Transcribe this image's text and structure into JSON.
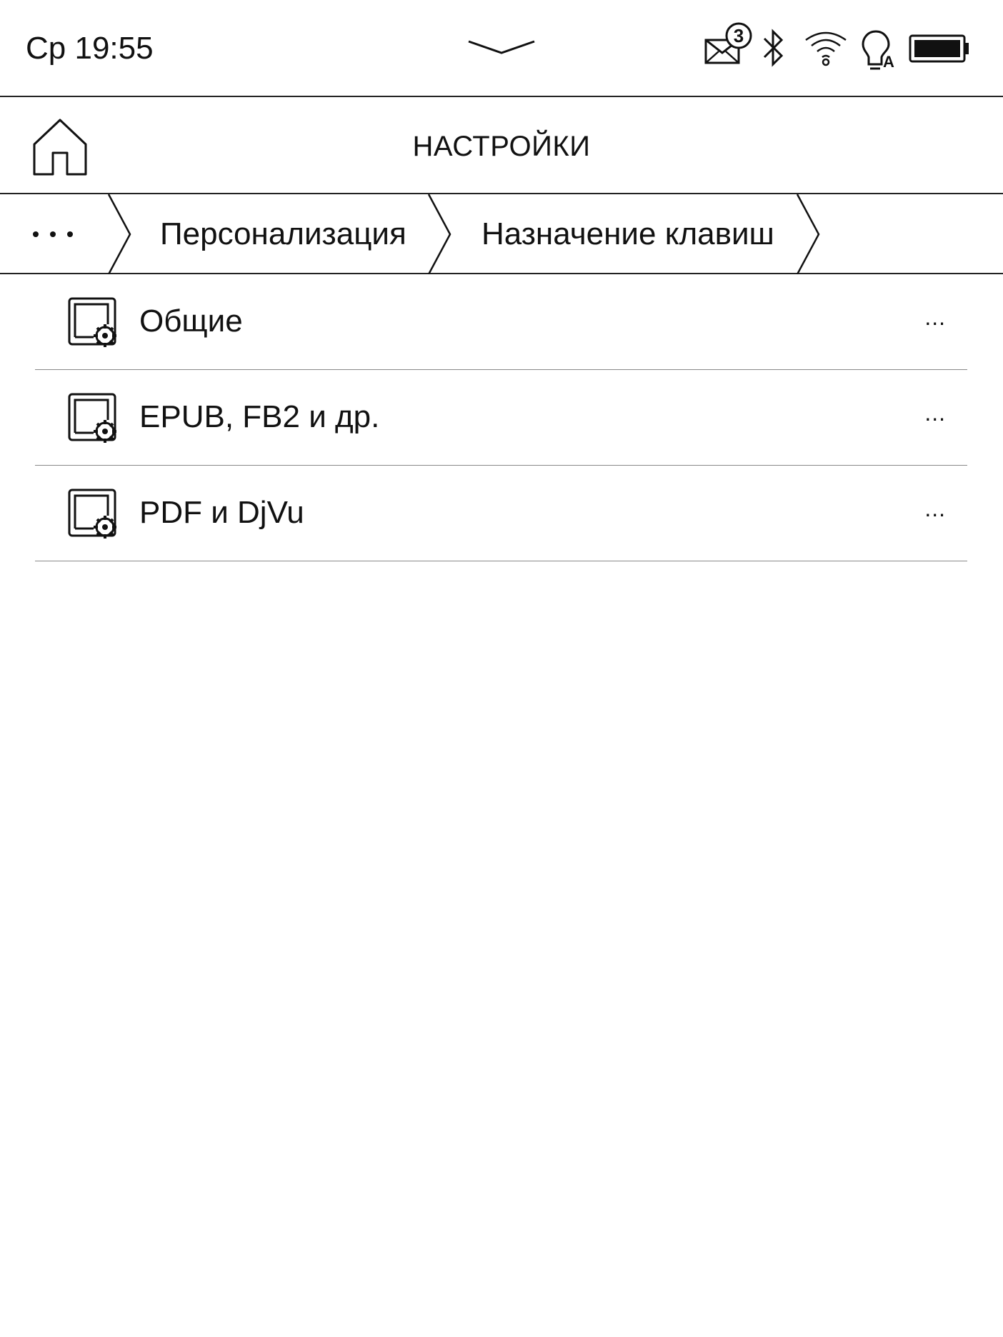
{
  "status_bar": {
    "clock": "Ср 19:55",
    "mail_count": "3",
    "icons": [
      "mail-icon",
      "bluetooth-icon",
      "wifi-icon",
      "frontlight-auto-icon",
      "battery-icon"
    ],
    "light_mode_letter": "A"
  },
  "header": {
    "title": "НАСТРОЙКИ",
    "home_icon": "home-icon"
  },
  "breadcrumb": {
    "more_label": "···",
    "items": [
      "Персонализация",
      "Назначение клавиш"
    ]
  },
  "list": {
    "items": [
      {
        "label": "Общие",
        "more": "...",
        "icon": "settings-page-icon"
      },
      {
        "label": "EPUB, FB2 и др.",
        "more": "...",
        "icon": "settings-page-icon"
      },
      {
        "label": "PDF и DjVu",
        "more": "...",
        "icon": "settings-page-icon"
      }
    ]
  }
}
